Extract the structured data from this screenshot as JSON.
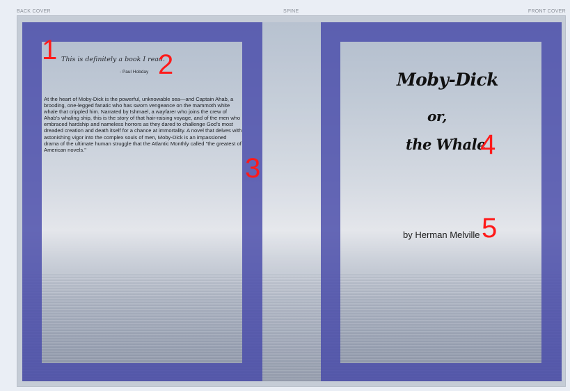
{
  "labels": {
    "back_cover": "BACK COVER",
    "spine": "SPINE",
    "front_cover": "FRONT COVER"
  },
  "back_cover": {
    "quote": "This is definitely a book I read.",
    "attribution": "- Paul Hobday",
    "blurb": "At the heart of Moby-Dick is the powerful, unknowable sea—and Captain Ahab, a brooding, one-legged fanatic who has sworn vengeance on the mammoth white whale that crippled him. Narrated by Ishmael, a wayfarer who joins the crew of Ahab's whaling ship, this is the story of that hair-raising voyage, and of the men who embraced hardship and nameless horrors as they dared to challenge God's most dreaded creation and death itself for a chance at immortality. A novel that delves with astonishing vigor into the complex souls of men, Moby-Dick is an impassioned drama of the ultimate human struggle that the Atlantic Monthly called \"the greatest of American novels.\""
  },
  "front_cover": {
    "title_lines": [
      "Moby-Dick",
      "or,",
      "the Whale"
    ],
    "author": "by Herman Melville"
  },
  "markers": [
    "1",
    "2",
    "3",
    "4",
    "5"
  ],
  "colors": {
    "frame_purple": "#4a4aaa",
    "marker_red": "#ff1a1a"
  }
}
